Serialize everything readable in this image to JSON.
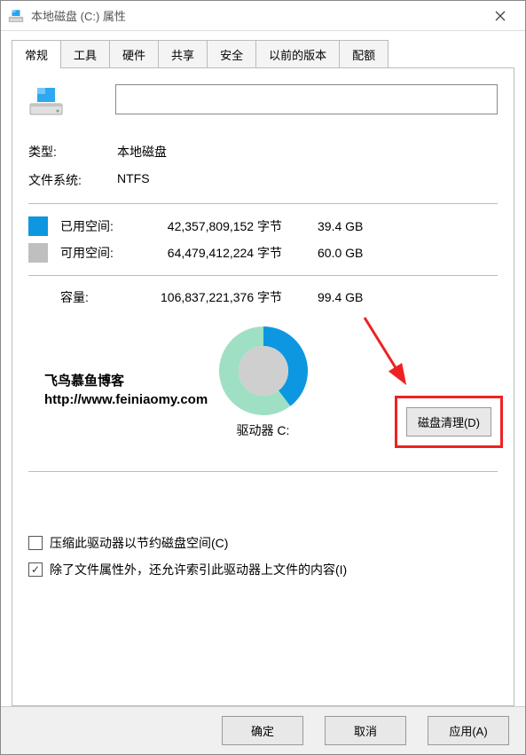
{
  "window": {
    "title": "本地磁盘 (C:) 属性"
  },
  "tabs": [
    "常规",
    "工具",
    "硬件",
    "共享",
    "安全",
    "以前的版本",
    "配额"
  ],
  "activeTabIndex": 0,
  "drive": {
    "name_input": "",
    "type_label": "类型:",
    "type_value": "本地磁盘",
    "fs_label": "文件系统:",
    "fs_value": "NTFS",
    "used_label": "已用空间:",
    "used_bytes": "42,357,809,152 字节",
    "used_gb": "39.4 GB",
    "free_label": "可用空间:",
    "free_bytes": "64,479,412,224 字节",
    "free_gb": "60.0 GB",
    "cap_label": "容量:",
    "cap_bytes": "106,837,221,376 字节",
    "cap_gb": "99.4 GB",
    "drive_under": "驱动器 C:",
    "cleanup_btn": "磁盘清理(D)"
  },
  "chart_data": {
    "type": "pie",
    "title": "",
    "series": [
      {
        "name": "已用空间",
        "value": 39.4,
        "color": "#0d97e0"
      },
      {
        "name": "可用空间",
        "value": 60.0,
        "color": "#9fe0c4"
      }
    ],
    "inner_color": "#cfcfcf"
  },
  "watermark": {
    "line1": "飞鸟慕鱼博客",
    "line2": "http://www.feiniaomy.com"
  },
  "checks": {
    "compress": {
      "checked": false,
      "label": "压缩此驱动器以节约磁盘空间(C)"
    },
    "index": {
      "checked": true,
      "label": "除了文件属性外，还允许索引此驱动器上文件的内容(I)"
    }
  },
  "footer": {
    "ok": "确定",
    "cancel": "取消",
    "apply": "应用(A)"
  }
}
